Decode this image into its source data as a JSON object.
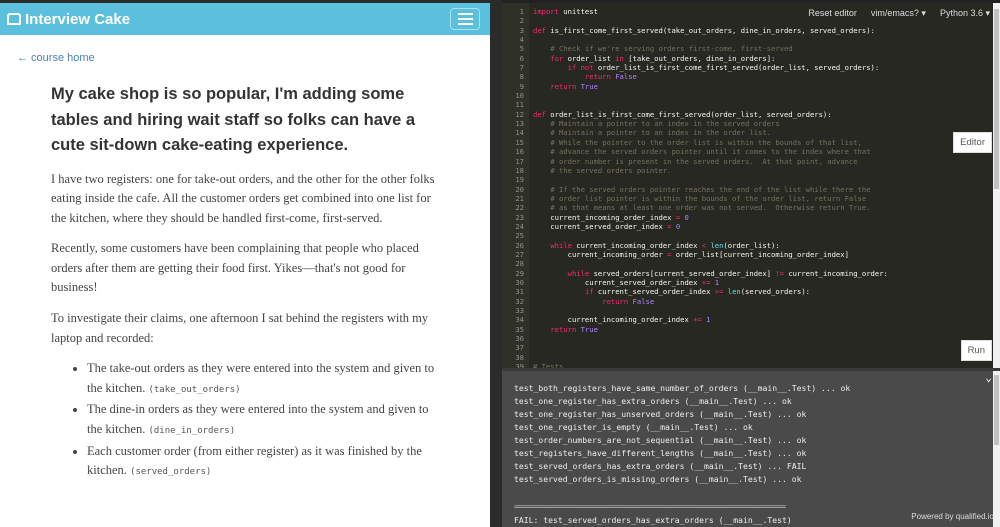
{
  "nav": {
    "brand": "Interview Cake",
    "back_link": "← course home"
  },
  "article": {
    "title": "My cake shop is so popular, I'm adding some tables and hiring wait staff so folks can have a cute sit-down cake-eating experience.",
    "p1": "I have two registers: one for take-out orders, and the other for the other folks eating inside the cafe. All the customer orders get combined into one list for the kitchen, where they should be handled first-come, first-served.",
    "p2": "Recently, some customers have been complaining that people who placed orders after them are getting their food first. Yikes—that's not good for business!",
    "p3": "To investigate their claims, one afternoon I sat behind the registers with my laptop and recorded:",
    "bullets": [
      {
        "text": "The take-out orders as they were entered into the system and given to the kitchen. ",
        "code": "(take_out_orders)"
      },
      {
        "text": "The dine-in orders as they were entered into the system and given to the kitchen. ",
        "code": "(dine_in_orders)"
      },
      {
        "text": "Each customer order (from either register) as it was finished by the kitchen. ",
        "code": "(served_orders)"
      }
    ]
  },
  "editor": {
    "reset": "Reset editor",
    "keybind": "vim/emacs? ▾",
    "language": "Python 3.6 ▾",
    "editor_btn": "Editor",
    "run_btn": "Run",
    "code": [
      "import unittest",
      "",
      "def is_first_come_first_served(take_out_orders, dine_in_orders, served_orders):",
      "",
      "    # Check if we're serving orders first-come, first-served",
      "    for order_list in [take_out_orders, dine_in_orders]:",
      "        if not order_list_is_first_come_first_served(order_list, served_orders):",
      "            return False",
      "    return True",
      "",
      "",
      "def order_list_is_first_come_first_served(order_list, served_orders):",
      "    # Maintain a pointer to an index in the served orders",
      "    # Maintain a pointer to an index in the order list.",
      "    # While the pointer to the order list is within the bounds of that list,",
      "    # advance the served orders pointer until it comes to the index where that",
      "    # order number is present in the served orders.  At that point, advance",
      "    # the served orders pointer.",
      "",
      "    # If the served orders pointer reaches the end of the list while there the",
      "    # order list pointer is within the bounds of the order list, return False",
      "    # as that means at least one order was not served.  Otherwise return True.",
      "    current_incoming_order_index = 0",
      "    current_served_order_index = 0",
      "",
      "    while current_incoming_order_index < len(order_list):",
      "        current_incoming_order = order_list[current_incoming_order_index]",
      "",
      "        while served_orders[current_served_order_index] != current_incoming_order:",
      "            current_served_order_index += 1",
      "            if current_served_order_index >= len(served_orders):",
      "                return False",
      "",
      "        current_incoming_order_index += 1",
      "    return True",
      "",
      "",
      "",
      "# Tests"
    ]
  },
  "output": {
    "lines": [
      "test_both_registers_have_same_number_of_orders (__main__.Test) ... ok",
      "test_one_register_has_extra_orders (__main__.Test) ... ok",
      "test_one_register_has_unserved_orders (__main__.Test) ... ok",
      "test_one_register_is_empty (__main__.Test) ... ok",
      "test_order_numbers_are_not_sequential (__main__.Test) ... ok",
      "test_registers_have_different_lengths (__main__.Test) ... ok",
      "test_served_orders_has_extra_orders (__main__.Test) ... FAIL",
      "test_served_orders_is_missing_orders (__main__.Test) ... ok"
    ],
    "separator": "======================================================================",
    "fail_line": "FAIL: test_served_orders_has_extra_orders (__main__.Test)",
    "powered": "Powered by qualified.io"
  }
}
